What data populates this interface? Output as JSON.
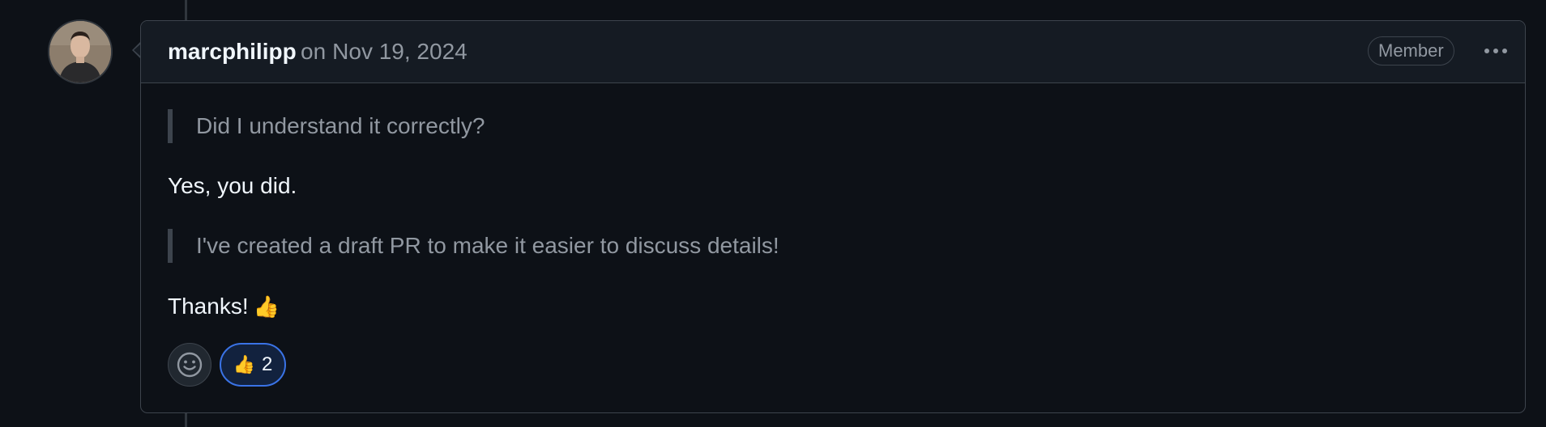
{
  "comment": {
    "author": "marcphilipp",
    "on_word": "on",
    "date": "Nov 19, 2024",
    "role_badge": "Member",
    "blockquote_1": "Did I understand it correctly?",
    "paragraph_1": "Yes, you did.",
    "blockquote_2": "I've created a draft PR to make it easier to discuss details!",
    "paragraph_2": "Thanks!",
    "paragraph_2_emoji": "👍"
  },
  "reactions": {
    "add_icon": "smiley-icon",
    "items": [
      {
        "emoji": "👍",
        "count": "2"
      }
    ]
  },
  "icons": {
    "more": "kebab-horizontal-icon",
    "avatar": "user-avatar"
  },
  "colors": {
    "background": "#0d1117",
    "header_background": "#151b23",
    "border": "#3d444d",
    "text_primary": "#f0f6fc",
    "text_muted": "#9198a1",
    "reaction_active_border": "#3a73e6"
  }
}
